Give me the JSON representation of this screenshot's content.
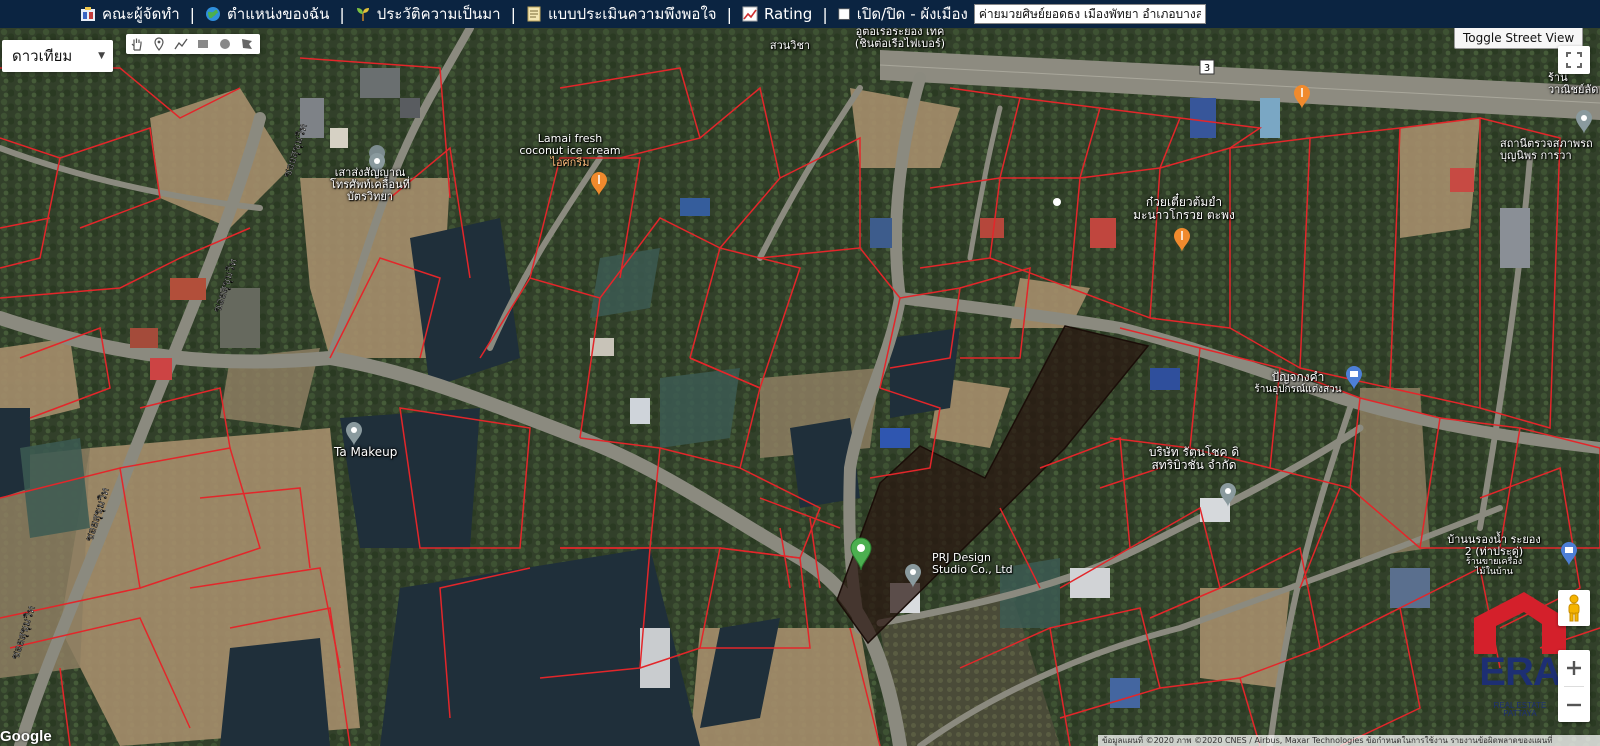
{
  "toolbar": {
    "items": [
      {
        "label": "คณะผู้จัดทำ",
        "icon": "team-icon"
      },
      {
        "label": "ตำแหน่งของฉัน",
        "icon": "globe-icon"
      },
      {
        "label": "ประวัติความเป็นมา",
        "icon": "sprout-icon"
      },
      {
        "label": "แบบประเมินความพึงพอใจ",
        "icon": "clipboard-icon"
      },
      {
        "label": "Rating",
        "icon": "chart-icon"
      },
      {
        "label": "เปิด/ปิด - ผังเมือง",
        "icon": "checkbox-icon"
      }
    ],
    "search_value": "ค่ายมวยศิษย์ยอดธง เมืองพัทยา อำเภอบางละ"
  },
  "map_type": {
    "label": "ดาวเทียม"
  },
  "toggle_street_view": "Toggle Street View",
  "road_shield": "3",
  "road_labels": [
    "ซอยสุขุมวิท",
    "ซอยสุขุมวิท",
    "ซอยสุขุมวิท",
    "ซอยสุขุมวิท"
  ],
  "pois": {
    "lamai": {
      "line1": "Lamai fresh",
      "line2": "coconut ice cream",
      "line3": "ไอศกรีม"
    },
    "sao_song": {
      "line1": "เสาส่งสัญญาณ",
      "line2": "โทรศัพท์เคลื่อนที่",
      "line3": "บัตรวิทยา"
    },
    "ta_makeup": {
      "line1": "Ta Makeup"
    },
    "kuay_tiew": {
      "line1": "ก๋วยเตี๋ยวต้มยำ",
      "line2": "มะนาวโกรวย ตะพง"
    },
    "panya": {
      "line1": "ปัญจกงคำ",
      "line2": "ร้านอุปกรณ์แต่งสวน"
    },
    "borisat": {
      "line1": "บริษัท รัตนโชค ดิ",
      "line2": "สทริบิวชั่น จำกัด"
    },
    "prj": {
      "line1": "PRJ Design",
      "line2": "Studio Co., Ltd"
    },
    "suan_wicha": {
      "line1": "สวนวิชา"
    },
    "top_center": {
      "line1": "อู่ต่อเรือระยอง เทค",
      "line2": "(ชินต่อเรือไฟเบอร์)"
    },
    "ban_narong": {
      "line1": "บ้านนรองน้ำ ระยอง",
      "line2": "2 (ท่าประดู่)",
      "line3": "ร้านขายเครื่อง",
      "line4": "ไม้ในบ้าน"
    },
    "right_top": {
      "line1": "ร้าน",
      "line2": "วาณิชย์ลัด"
    },
    "right_station": {
      "line1": "สถานีตรวจสภาพรถ",
      "line2": "บุญนิพร การวา"
    }
  },
  "branding": {
    "name": "ERA",
    "sub1": "REAL ESTATE",
    "sub2": "PATTAYA",
    "color": "#1d2f73",
    "accent": "#d4202b"
  },
  "google_logo": "Google",
  "attribution": "ข้อมูลแผนที่ ©2020 ภาพ ©2020 CNES / Airbus, Maxar Technologies   ข้อกำหนดในการใช้งาน   รายงานข้อผิดพลาดของแผนที่"
}
